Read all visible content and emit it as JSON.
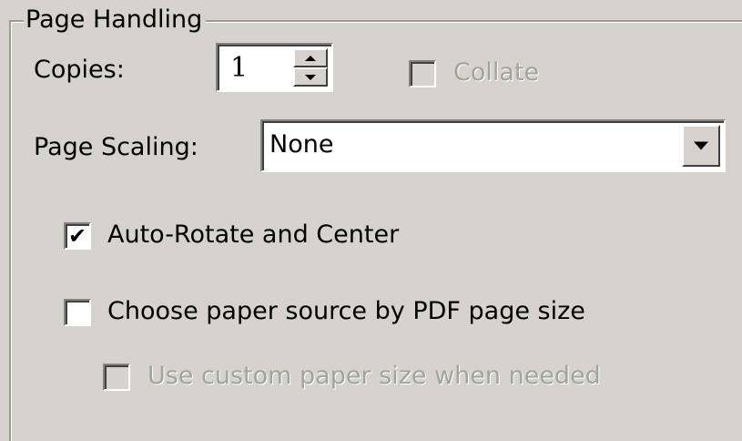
{
  "group": {
    "title": "Page Handling"
  },
  "copies": {
    "label": "Copies:",
    "value": "1"
  },
  "collate": {
    "label": "Collate",
    "checked": false,
    "enabled": false
  },
  "scaling": {
    "label": "Page Scaling:",
    "value": "None"
  },
  "auto_rotate": {
    "label": "Auto-Rotate and Center",
    "checked": true
  },
  "paper_source": {
    "label": "Choose paper source by PDF page size",
    "checked": false
  },
  "custom_paper": {
    "label": "Use custom paper size when needed",
    "checked": false,
    "enabled": false
  },
  "icons": {
    "spin_up": "spin-up-arrow",
    "spin_down": "spin-down-arrow",
    "dropdown": "chevron-down"
  },
  "colors": {
    "background": "#d6d3ce",
    "disabled_text": "#a5a29b"
  }
}
